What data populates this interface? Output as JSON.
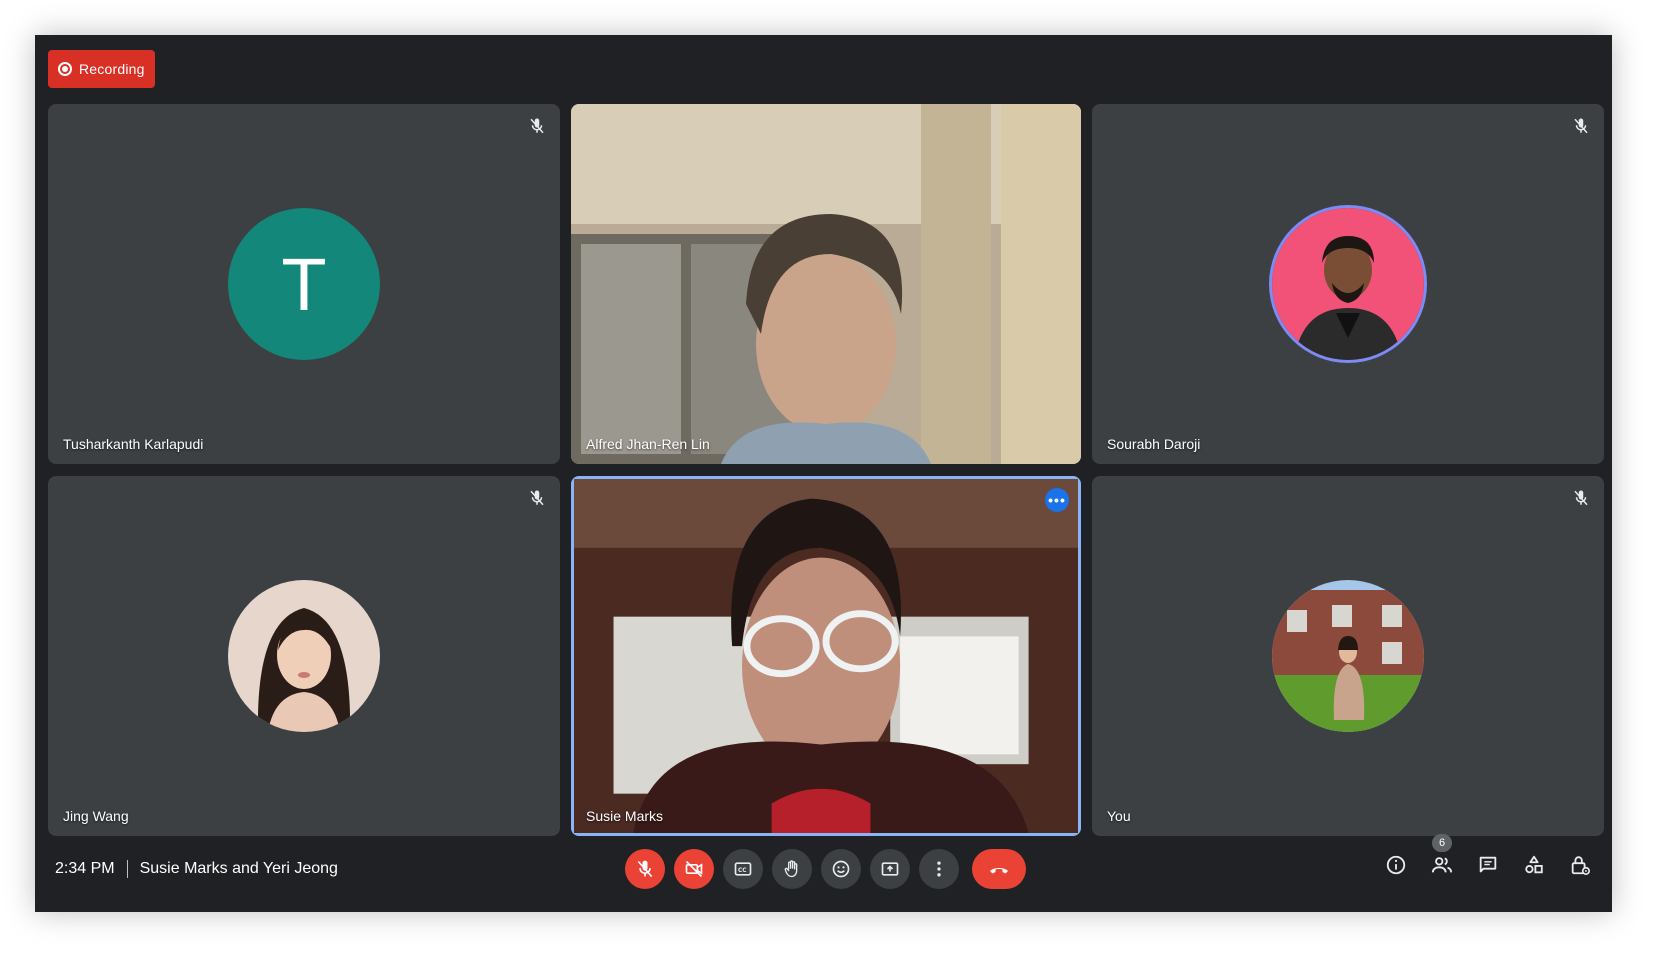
{
  "recording": {
    "label": "Recording",
    "color": "#d93025"
  },
  "participants": [
    {
      "name": "Tusharkanth Karlapudi",
      "avatar_letter": "T",
      "avatar_color": "#12877a",
      "muted": true
    },
    {
      "name": "Alfred Jhan-Ren Lin",
      "video": true
    },
    {
      "name": "Sourabh Daroji",
      "avatar_bg": "#f25178",
      "muted": true
    },
    {
      "name": "Jing Wang",
      "muted": true
    },
    {
      "name": "Susie Marks",
      "video": true,
      "active_speaker": true
    },
    {
      "name": "You",
      "muted": true
    }
  ],
  "footer": {
    "time": "2:34 PM",
    "meeting_title": "Susie Marks and Yeri Jeong",
    "participant_count": "6"
  },
  "controls": [
    {
      "name": "mic-off-icon",
      "state": "off"
    },
    {
      "name": "camera-off-icon",
      "state": "off"
    },
    {
      "name": "captions-icon"
    },
    {
      "name": "raise-hand-icon"
    },
    {
      "name": "emoji-icon"
    },
    {
      "name": "present-screen-icon"
    },
    {
      "name": "more-options-icon"
    },
    {
      "name": "hang-up-icon"
    }
  ],
  "right_controls": [
    "info-icon",
    "people-icon",
    "chat-icon",
    "activities-icon",
    "host-controls-icon"
  ],
  "colors": {
    "background": "#202124",
    "tile": "#3c4043",
    "accent": "#1a73e8",
    "danger": "#ea4335"
  }
}
